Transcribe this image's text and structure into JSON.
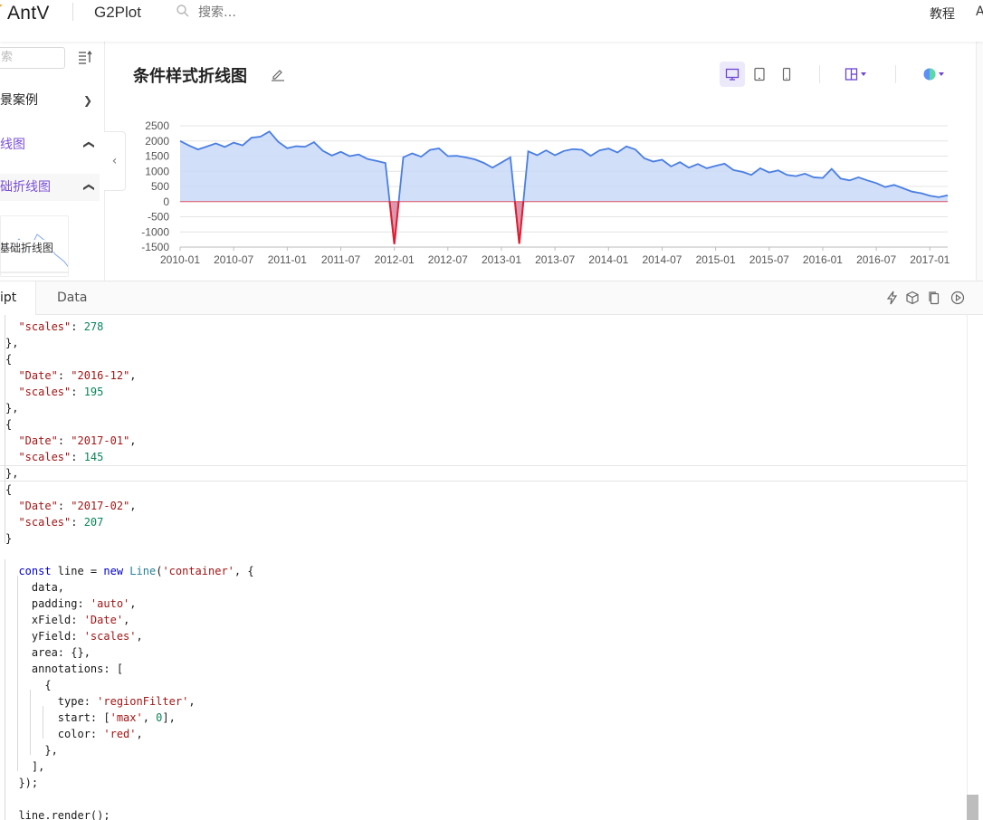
{
  "header": {
    "logo": "AntV",
    "product": "G2Plot",
    "search_placeholder": "搜索…",
    "links": [
      "教程",
      "A"
    ]
  },
  "sidebar": {
    "search_placeholder": "索",
    "items": [
      {
        "label": "景案例",
        "chevron": "up-down",
        "color": "#222"
      },
      {
        "label": "线图",
        "chevron": "up",
        "color": "#7b4fd6"
      },
      {
        "label": "础折线图",
        "chevron": "up",
        "color": "#7b4fd6"
      }
    ],
    "thumbnail_label": "基础折线图"
  },
  "preview": {
    "title": "条件样式折线图",
    "toolbar": [
      "desktop-icon",
      "tablet-icon",
      "mobile-icon",
      "layout-icon",
      "theme-icon"
    ]
  },
  "chart_data": {
    "type": "area",
    "x_field": "Date",
    "y_field": "scales",
    "ylim": [
      -1500,
      2500
    ],
    "y_ticks": [
      "2500",
      "2000",
      "1500",
      "1000",
      "500",
      "0",
      "-500",
      "-1000",
      "-1500"
    ],
    "x_ticks": [
      "2010-01",
      "2010-07",
      "2011-01",
      "2011-07",
      "2012-01",
      "2012-07",
      "2013-01",
      "2013-07",
      "2014-01",
      "2014-07",
      "2015-01",
      "2015-07",
      "2016-01",
      "2016-07",
      "2017-01"
    ],
    "x": [
      "2010-01",
      "2010-02",
      "2010-03",
      "2010-04",
      "2010-05",
      "2010-06",
      "2010-07",
      "2010-08",
      "2010-09",
      "2010-10",
      "2010-11",
      "2010-12",
      "2011-01",
      "2011-02",
      "2011-03",
      "2011-04",
      "2011-05",
      "2011-06",
      "2011-07",
      "2011-08",
      "2011-09",
      "2011-10",
      "2011-11",
      "2011-12",
      "2012-01",
      "2012-02",
      "2012-03",
      "2012-04",
      "2012-05",
      "2012-06",
      "2012-07",
      "2012-08",
      "2012-09",
      "2012-10",
      "2012-11",
      "2012-12",
      "2013-01",
      "2013-02",
      "2013-03",
      "2013-04",
      "2013-05",
      "2013-06",
      "2013-07",
      "2013-08",
      "2013-09",
      "2013-10",
      "2013-11",
      "2013-12",
      "2014-01",
      "2014-02",
      "2014-03",
      "2014-04",
      "2014-05",
      "2014-06",
      "2014-07",
      "2014-08",
      "2014-09",
      "2014-10",
      "2014-11",
      "2014-12",
      "2015-01",
      "2015-02",
      "2015-03",
      "2015-04",
      "2015-05",
      "2015-06",
      "2015-07",
      "2015-08",
      "2015-09",
      "2015-10",
      "2015-11",
      "2015-12",
      "2016-01",
      "2016-02",
      "2016-03",
      "2016-04",
      "2016-05",
      "2016-06",
      "2016-07",
      "2016-08",
      "2016-09",
      "2016-10",
      "2016-11",
      "2016-12",
      "2017-01",
      "2017-02"
    ],
    "values": [
      1998,
      1850,
      1720,
      1818,
      1920,
      1802,
      1945,
      1856,
      2107,
      2140,
      2311,
      1972,
      1760,
      1827,
      1809,
      1961,
      1674,
      1520,
      1642,
      1498,
      1555,
      1405,
      1344,
      1273,
      -1400,
      1460,
      1590,
      1480,
      1705,
      1755,
      1500,
      1510,
      1460,
      1395,
      1280,
      1120,
      1290,
      1460,
      -1390,
      1660,
      1530,
      1690,
      1530,
      1670,
      1730,
      1710,
      1510,
      1690,
      1750,
      1620,
      1820,
      1720,
      1430,
      1320,
      1380,
      1160,
      1300,
      1120,
      1240,
      1100,
      1180,
      1250,
      1040,
      980,
      880,
      1100,
      960,
      1030,
      880,
      840,
      920,
      800,
      780,
      1080,
      760,
      700,
      800,
      700,
      610,
      480,
      550,
      440,
      330,
      278,
      195,
      145,
      207
    ],
    "area": true,
    "annotation": {
      "type": "regionFilter",
      "start": [
        "max",
        0
      ],
      "color": "red"
    },
    "line_color": "#4a7ee3",
    "area_color": "#c9d9f8",
    "filter_color": "#e8192c"
  },
  "editor": {
    "tabs": [
      "ipt",
      "Data"
    ],
    "toolbar": [
      "lightning-icon",
      "codesandbox-icon",
      "copy-icon",
      "play-icon"
    ]
  },
  "code": {
    "lines": [
      "  \"scales\": 278",
      "},",
      "{",
      "  \"Date\": \"2016-12\",",
      "  \"scales\": 195",
      "},",
      "{",
      "  \"Date\": \"2017-01\",",
      "  \"scales\": 145",
      "},",
      "{",
      "  \"Date\": \"2017-02\",",
      "  \"scales\": 207",
      "}",
      "",
      "  const line = new Line('container', {",
      "    data,",
      "    padding: 'auto',",
      "    xField: 'Date',",
      "    yField: 'scales',",
      "    area: {},",
      "    annotations: [",
      "      {",
      "        type: 'regionFilter',",
      "        start: ['max', 0],",
      "        color: 'red',",
      "      },",
      "    ],",
      "  });",
      "",
      "  line.render();"
    ]
  }
}
